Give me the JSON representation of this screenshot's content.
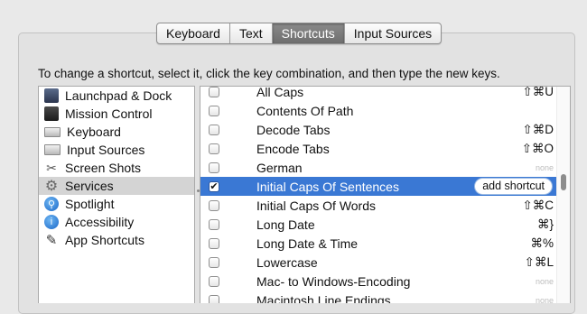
{
  "tabs": [
    "Keyboard",
    "Text",
    "Shortcuts",
    "Input Sources"
  ],
  "selected_tab": "Shortcuts",
  "instruction": "To change a shortcut, select it, click the key combination, and then type the new keys.",
  "categories": [
    {
      "label": "Launchpad & Dock",
      "icon": "launchpad-icon"
    },
    {
      "label": "Mission Control",
      "icon": "mission-control-icon"
    },
    {
      "label": "Keyboard",
      "icon": "keyboard-icon"
    },
    {
      "label": "Input Sources",
      "icon": "input-sources-icon"
    },
    {
      "label": "Screen Shots",
      "icon": "screenshot-icon"
    },
    {
      "label": "Services",
      "icon": "gear-icon",
      "selected": true
    },
    {
      "label": "Spotlight",
      "icon": "spotlight-icon"
    },
    {
      "label": "Accessibility",
      "icon": "accessibility-icon"
    },
    {
      "label": "App Shortcuts",
      "icon": "app-shortcuts-icon"
    }
  ],
  "services": [
    {
      "name": "All Caps",
      "shortcut": "⇧⌘U",
      "checked": false
    },
    {
      "name": "Contents Of Path",
      "shortcut": "",
      "checked": false
    },
    {
      "name": "Decode Tabs",
      "shortcut": "⇧⌘D",
      "checked": false
    },
    {
      "name": "Encode Tabs",
      "shortcut": "⇧⌘O",
      "checked": false
    },
    {
      "name": "German",
      "shortcut": "none",
      "checked": false
    },
    {
      "name": "Initial Caps Of Sentences",
      "shortcut": "add shortcut",
      "checked": true,
      "selected": true
    },
    {
      "name": "Initial Caps Of Words",
      "shortcut": "⇧⌘C",
      "checked": false
    },
    {
      "name": "Long Date",
      "shortcut": "⌘}",
      "checked": false
    },
    {
      "name": "Long Date & Time",
      "shortcut": "⌘%",
      "checked": false
    },
    {
      "name": "Lowercase",
      "shortcut": "⇧⌘L",
      "checked": false
    },
    {
      "name": "Mac- to Windows-Encoding",
      "shortcut": "none",
      "checked": false
    },
    {
      "name": "Macintosh Line Endings",
      "shortcut": "none",
      "checked": false
    }
  ],
  "colors": {
    "selection": "#3a78d4",
    "window_bg": "#e9e9e9",
    "selected_tab": "#7a7a7a"
  }
}
